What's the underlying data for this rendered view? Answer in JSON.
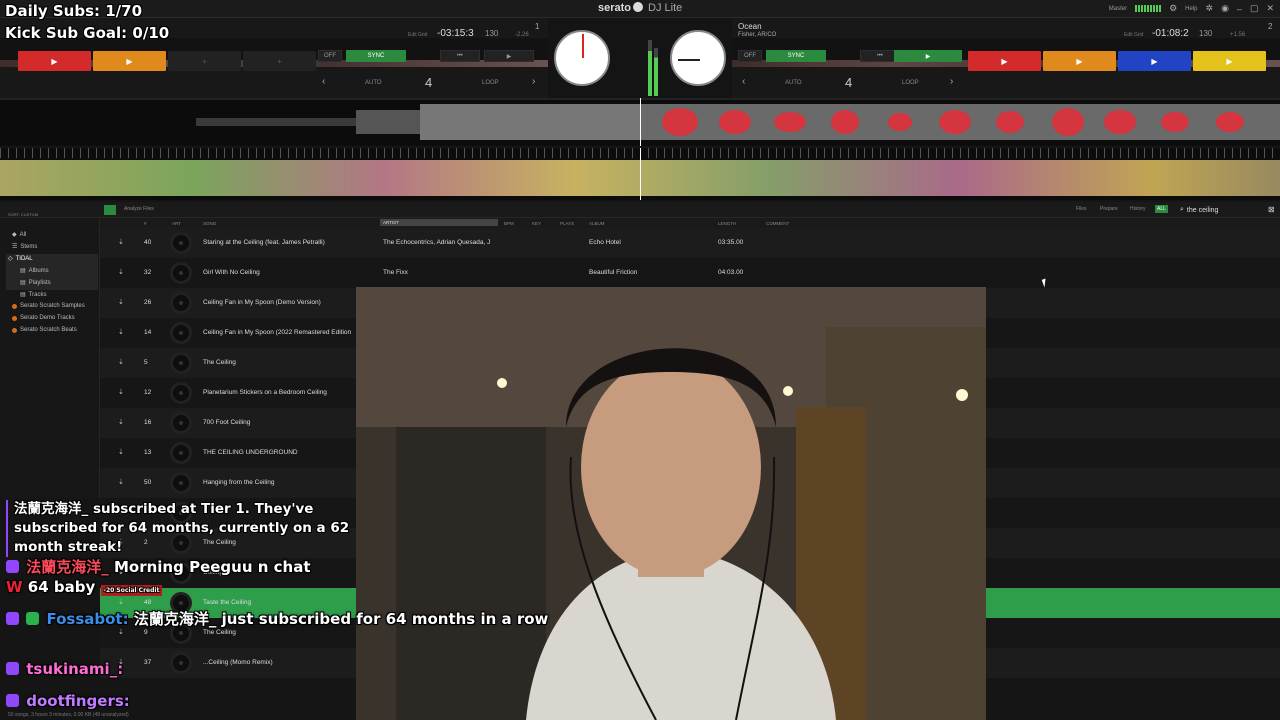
{
  "overlay": {
    "daily_subs": "Daily Subs: 1/70",
    "kick_goal": "Kick Sub Goal: 0/10"
  },
  "app": {
    "brand": "serato",
    "edition": "DJ Lite",
    "deck_numbers": [
      "1",
      "2"
    ],
    "top_right": {
      "master_label": "Master",
      "help_label": "Help"
    }
  },
  "deck_left": {
    "time": "-03:15:3",
    "bpm": "130",
    "pitch": "-2.26",
    "edit_grid": "Edit Grid",
    "off_label": "OFF",
    "sync_label": "SYNC",
    "auto_label": "AUTO",
    "loop_value": "4",
    "loop_label": "LOOP",
    "pads": [
      {
        "color": "#d32b2b",
        "icon": "play"
      },
      {
        "color": "#e08a1e",
        "icon": "play"
      },
      {
        "color": "",
        "icon": "plus"
      },
      {
        "color": "",
        "icon": "plus"
      }
    ]
  },
  "deck_right": {
    "title": "Ocean",
    "artist": "Fisher, AR/CO",
    "time": "-01:08:2",
    "bpm": "130",
    "pitch": "+1.56",
    "edit_grid": "Edit Grid",
    "off_label": "OFF",
    "sync_label": "SYNC",
    "auto_label": "AUTO",
    "loop_value": "4",
    "loop_label": "LOOP",
    "pads": [
      {
        "color": "#d32b2b",
        "icon": "play"
      },
      {
        "color": "#e08a1e",
        "icon": "play"
      },
      {
        "color": "#2243c4",
        "icon": "play"
      },
      {
        "color": "#e4c21c",
        "icon": "play"
      }
    ]
  },
  "library": {
    "toolbar": {
      "sort_label": "SORT: CUSTOM",
      "analyze": "Analyze Files",
      "files": "Files",
      "prepare": "Prepare",
      "history": "History",
      "all_label": "ALL",
      "search_value": "the ceiling"
    },
    "sidebar": {
      "all": "All",
      "stems": "Stems",
      "tidal": "TIDAL",
      "albums": "Albums",
      "playlists": "Playlists",
      "tracks": "Tracks",
      "samples": "Serato Scratch Samples",
      "demo": "Serato Demo Tracks",
      "beats": "Serato Scratch Beats"
    },
    "columns": {
      "num": "#",
      "art": "ART",
      "song": "SONG",
      "artist": "ARTIST",
      "bpm": "BPM",
      "key": "KEY",
      "plays": "PLAYS",
      "album": "ALBUM",
      "length": "LENGTH",
      "comment": "COMMENT"
    },
    "rows": [
      {
        "num": "40",
        "song": "Staring at the Ceiling (feat. James Petralli)",
        "artist": "The Echocentrics, Adrian Quesada, J",
        "album": "Echo Hotel",
        "length": "03:35.00"
      },
      {
        "num": "32",
        "song": "Girl With No Ceiling",
        "artist": "The Fixx",
        "album": "Beautiful Friction",
        "length": "04:03.00"
      },
      {
        "num": "26",
        "song": "Ceiling Fan in My Spoon (Demo Version)",
        "artist": "",
        "album": "",
        "length": ""
      },
      {
        "num": "14",
        "song": "Ceiling Fan in My Spoon (2022 Remastered Edition",
        "artist": "",
        "album": "",
        "length": ""
      },
      {
        "num": "5",
        "song": "The Ceiling",
        "artist": "",
        "album": "",
        "length": ""
      },
      {
        "num": "12",
        "song": "Planetarium Stickers on a Bedroom Ceiling",
        "artist": "",
        "album": "",
        "length": ""
      },
      {
        "num": "16",
        "song": "700 Foot Ceiling",
        "artist": "",
        "album": "",
        "length": ""
      },
      {
        "num": "13",
        "song": "THE CEILING UNDERGROUND",
        "artist": "",
        "album": "",
        "length": ""
      },
      {
        "num": "50",
        "song": "Hanging from the Ceiling",
        "artist": "",
        "album": "",
        "length": ""
      },
      {
        "num": "",
        "song": "",
        "artist": "",
        "album": "",
        "length": ""
      },
      {
        "num": "2",
        "song": "The Ceiling",
        "artist": "",
        "album": "",
        "length": ""
      },
      {
        "num": "",
        "song": "Ceiling",
        "artist": "",
        "album": "",
        "length": ""
      },
      {
        "num": "48",
        "song": "Taste the Ceiling",
        "artist": "",
        "album": "",
        "length": ""
      },
      {
        "num": "9",
        "song": "The Ceiling",
        "artist": "",
        "album": "",
        "length": ""
      },
      {
        "num": "37",
        "song": "...Ceiling (Momo Remix)",
        "artist": "",
        "album": "",
        "length": ""
      }
    ],
    "status": "50 songs, 3 hours 3 minutes, 0.00 KB (49 unanalyzed)"
  },
  "chat": {
    "sub_notice": "法蘭克海洋_ subscribed at Tier 1. They've subscribed for 64 months, currently on a 62 month streak!",
    "messages": [
      {
        "user": "法蘭克海洋_",
        "user_color": "#ff4a5c",
        "text": "Morning Peeguu n chat",
        "extra": "64 baby"
      },
      {
        "user": "Fossabot:",
        "user_color": "#3a8ee6",
        "text": "法蘭克海洋_ just subscribed for 64 months in a row"
      },
      {
        "user": "tsukinami_:",
        "user_color": "#ff6bd5",
        "text": ""
      },
      {
        "user": "dootfingers:",
        "user_color": "#c07bff",
        "text": ""
      }
    ],
    "credit_badge": "-20 Social Credit"
  }
}
